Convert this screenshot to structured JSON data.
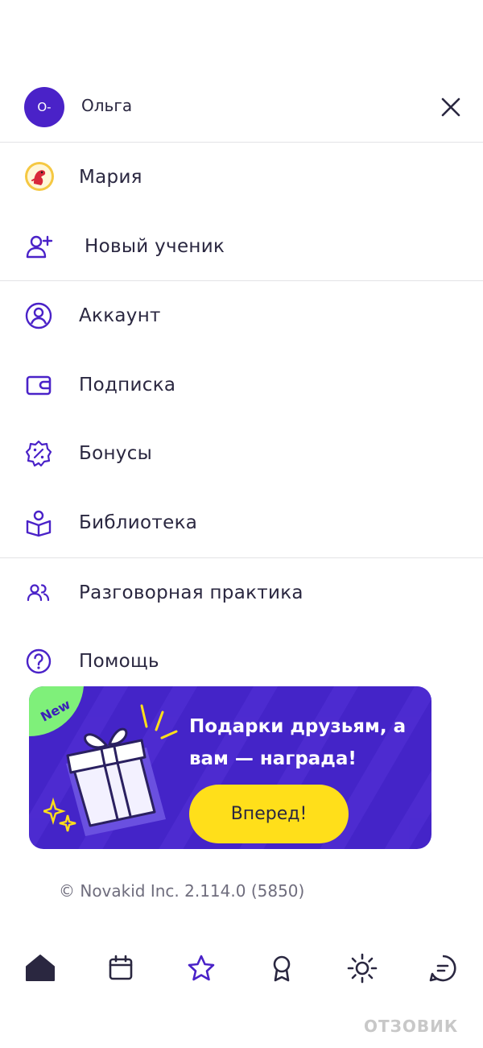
{
  "profile": {
    "avatar_text": "О-",
    "name": "Ольга"
  },
  "students": [
    {
      "name": "Мария"
    },
    {
      "name": "Новый ученик"
    }
  ],
  "menu": {
    "account": "Аккаунт",
    "subscription": "Подписка",
    "bonuses": "Бонусы",
    "library": "Библиотека",
    "speaking": "Разговорная практика",
    "help": "Помощь"
  },
  "promo": {
    "badge": "New",
    "title": "Подарки друзьям, а вам — награда!",
    "button": "Вперед!"
  },
  "footer": {
    "copyright": "© Novakid Inc. 2.114.0 (5850)"
  },
  "bottom_nav": [
    "home-icon",
    "calendar-icon",
    "star-icon",
    "award-icon",
    "sun-icon",
    "chat-icon"
  ],
  "watermark": "ОТЗОВИК",
  "colors": {
    "accent": "#4a22c8",
    "promo_bg": "#4424c8",
    "button_yellow": "#ffdf1a",
    "badge_green": "#7ff07a"
  }
}
